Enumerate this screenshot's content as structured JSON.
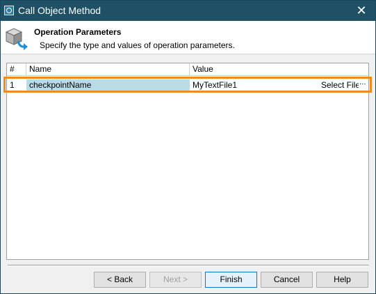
{
  "window": {
    "title": "Call Object Method",
    "close_glyph": "✕"
  },
  "header": {
    "title": "Operation Parameters",
    "subtitle": "Specify the type and values of operation parameters."
  },
  "grid": {
    "columns": [
      "#",
      "Name",
      "Value"
    ],
    "rows": [
      {
        "index": "1",
        "name": "checkpointName",
        "value": "MyTextFile1",
        "action": "Select File",
        "ellipsis": "···"
      }
    ]
  },
  "buttons": {
    "back": "< Back",
    "next": "Next >",
    "finish": "Finish",
    "cancel": "Cancel",
    "help": "Help"
  },
  "colors": {
    "titlebar": "#1f5065",
    "selected_name_cell": "#b7dce6",
    "highlight_border": "#f08c1e"
  },
  "icons": [
    "app-icon",
    "close-icon",
    "method-box-icon",
    "ellipsis-icon"
  ]
}
